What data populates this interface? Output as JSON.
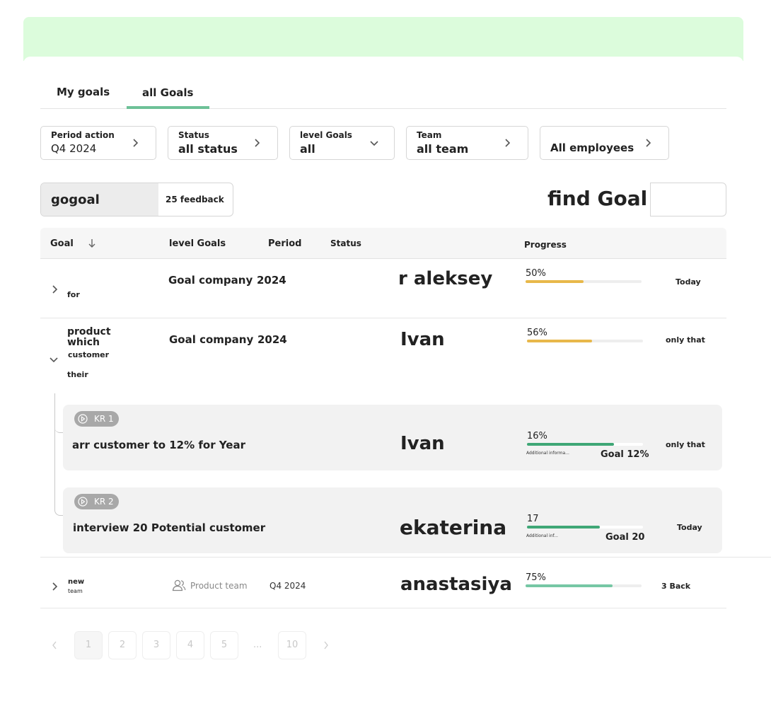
{
  "tabs": [
    {
      "label": "My goals"
    },
    {
      "label": "all Goals",
      "active": true
    }
  ],
  "filters": {
    "period": {
      "label": "Period action",
      "value": "Q4 2024"
    },
    "status": {
      "label": "Status",
      "value": "all status"
    },
    "level": {
      "label": "level Goals",
      "value": "all"
    },
    "team": {
      "label": "Team",
      "value": "all team"
    },
    "employees": {
      "value": "All employees"
    }
  },
  "view_toggle": {
    "option_a": "gogoal",
    "option_b": "25 feedback"
  },
  "search": {
    "label": "find Goal",
    "placeholder": ""
  },
  "table": {
    "columns": {
      "goal": "Goal",
      "level": "level Goals",
      "period": "Period",
      "status": "Status",
      "progress": "Progress"
    },
    "rows": [
      {
        "goal": "for",
        "level": "Goal company",
        "period": "2024",
        "owner": "r aleksey",
        "progress_label": "50%",
        "progress": 0.5,
        "deadline": "Today"
      },
      {
        "goal_line1": "product",
        "goal_line2": "which",
        "goal_line3": "customer",
        "goal_line4": "their",
        "level": "Goal company",
        "period": "2024",
        "owner": "Ivan",
        "progress_label": "56%",
        "progress": 0.56,
        "deadline": "only that",
        "key_results": [
          {
            "badge": "KR 1",
            "title": "arr customer to 12% for Year",
            "owner": "Ivan",
            "progress_label": "16%",
            "progress": 0.75,
            "note": "Additional informa...",
            "target": "Goal 12%",
            "deadline": "only that"
          },
          {
            "badge": "KR 2",
            "title": "interview 20 Potential customer",
            "owner": "ekaterina",
            "progress_label": "17",
            "progress": 0.63,
            "note": "Additional inf...",
            "target": "Goal 20",
            "deadline": "Today"
          }
        ]
      },
      {
        "goal_line1": "new",
        "goal_line2": "team",
        "level": "Product team",
        "period": "Q4  2024",
        "owner": "anastasiya",
        "progress_label": "75%",
        "progress": 0.75,
        "deadline": "3 Back"
      }
    ]
  },
  "pagination": {
    "pages": [
      "1",
      "2",
      "3",
      "4",
      "5"
    ],
    "ellipsis": "...",
    "last": "10",
    "current": "1"
  },
  "colors": {
    "banner": "#dcfcdc",
    "accent": "#6dc197",
    "bar_yellow": "#e8b84a",
    "bar_green": "#3fa776",
    "bar_teal": "#76c7a4"
  }
}
